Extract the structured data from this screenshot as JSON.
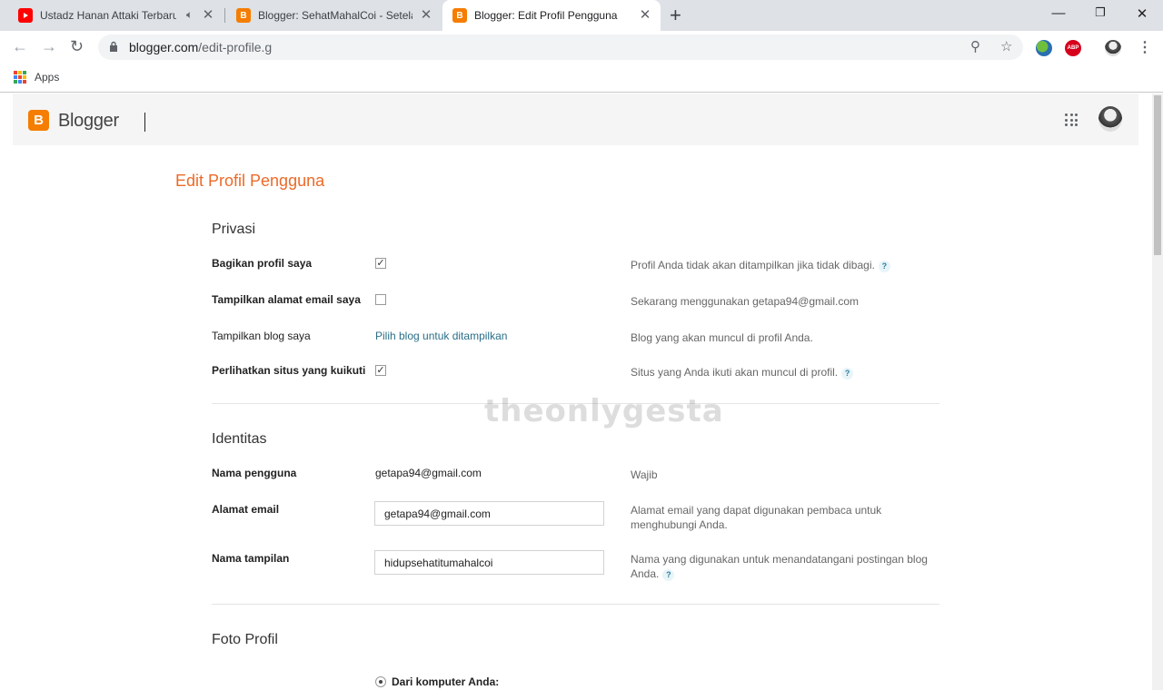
{
  "browser": {
    "tabs": [
      {
        "title": "Ustadz Hanan Attaki Terbaru",
        "favicon": "youtube-icon",
        "audio": true
      },
      {
        "title": "Blogger: SehatMahalCoi - Setelan",
        "favicon": "blogger-icon"
      },
      {
        "title": "Blogger: Edit Profil Pengguna",
        "favicon": "blogger-icon",
        "active": true
      }
    ],
    "address": {
      "domain": "blogger.com",
      "path": "/edit-profile.g"
    },
    "bookmarks": {
      "apps_label": "Apps"
    }
  },
  "header": {
    "logo_letter": "B",
    "brand": "Blogger"
  },
  "page": {
    "title": "Edit Profil Pengguna",
    "watermark": "theonlygesta"
  },
  "privacy": {
    "title": "Privasi",
    "rows": [
      {
        "label": "Bagikan profil saya",
        "checked": true,
        "help": "Profil Anda tidak akan ditampilkan jika tidak dibagi."
      },
      {
        "label": "Tampilkan alamat email saya",
        "checked": false,
        "help": "Sekarang menggunakan getapa94@gmail.com"
      },
      {
        "label": "Tampilkan blog saya",
        "link": "Pilih blog untuk ditampilkan",
        "help": "Blog yang akan muncul di profil Anda."
      },
      {
        "label": "Perlihatkan situs yang kuikuti",
        "checked": true,
        "help": "Situs yang Anda ikuti akan muncul di profil."
      }
    ]
  },
  "identity": {
    "title": "Identitas",
    "username_label": "Nama pengguna",
    "username_value": "getapa94@gmail.com",
    "username_help": "Wajib",
    "email_label": "Alamat email",
    "email_value": "getapa94@gmail.com",
    "email_help": "Alamat email yang dapat digunakan pembaca untuk menghubungi Anda.",
    "display_label": "Nama tampilan",
    "display_value": "hidupsehatitumahalcoi",
    "display_help": "Nama yang digunakan untuk menandatangani postingan blog Anda."
  },
  "photo": {
    "title": "Foto Profil",
    "option_label": "Dari komputer Anda:"
  },
  "help_glyph": "?",
  "check_glyph": "✓",
  "colors": {
    "accent": "#ec6a28",
    "blogger": "#f57d00",
    "link": "#2a6f88"
  }
}
